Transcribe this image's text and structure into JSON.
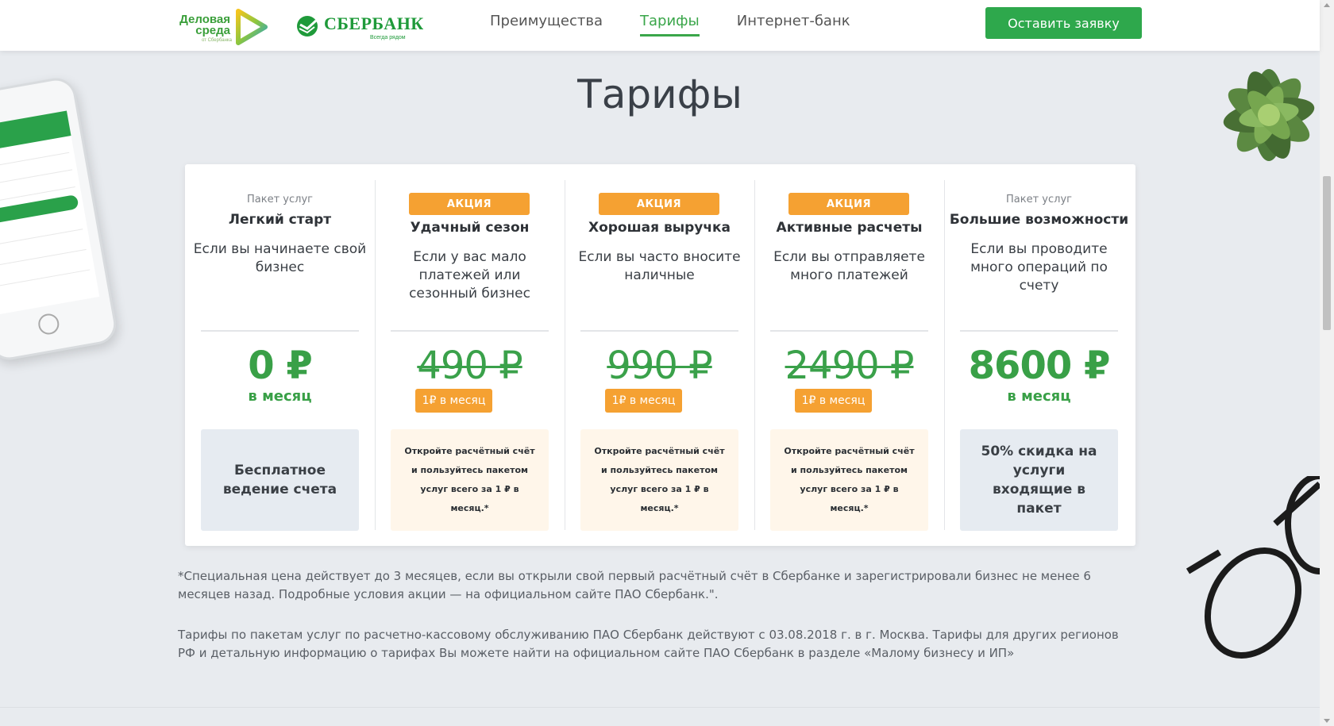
{
  "header": {
    "logo_delovaya": "Деловая среда",
    "logo_delovaya_sub": "от Сбербанка",
    "logo_sberbank": "СБЕРБАНК",
    "logo_sberbank_sub": "Всегда рядом",
    "nav": [
      {
        "label": "Преимущества",
        "active": false
      },
      {
        "label": "Тарифы",
        "active": true
      },
      {
        "label": "Интернет-банк",
        "active": false
      }
    ],
    "cta_label": "Оставить заявку"
  },
  "page_title": "Тарифы",
  "plans": [
    {
      "label": "Пакет услуг",
      "name": "Легкий старт",
      "description": "Если вы начинаете свой бизнес",
      "price": "0 ₽",
      "per_month": "в месяц",
      "box": "Бесплатное ведение счета"
    },
    {
      "badge": "АКЦИЯ",
      "name": "Удачный сезон",
      "description": "Если у вас мало платежей или сезонный бизнес",
      "old_price": "490 ₽",
      "promo_price": "1₽ в месяц",
      "box": "Откройте расчётный счёт и пользуйтесь пакетом услуг всего за 1 ₽ в месяц.*"
    },
    {
      "badge": "АКЦИЯ",
      "name": "Хорошая выручка",
      "description": "Если вы часто вносите наличные",
      "old_price": "990 ₽",
      "promo_price": "1₽ в месяц",
      "box": "Откройте расчётный счёт и пользуйтесь пакетом услуг всего за 1 ₽ в месяц.*"
    },
    {
      "badge": "АКЦИЯ",
      "name": "Активные расчеты",
      "description": "Если вы отправляете много платежей",
      "old_price": "2490 ₽",
      "promo_price": "1₽ в месяц",
      "box": "Откройте расчётный счёт и пользуйтесь пакетом услуг всего за 1 ₽ в месяц.*"
    },
    {
      "label": "Пакет услуг",
      "name": "Большие возможности",
      "description": "Если вы проводите много операций по счету",
      "price": "8600 ₽",
      "per_month": "в месяц",
      "box": "50% скидка на услуги входящие в пакет"
    }
  ],
  "notes": {
    "special": "*Специальная цена действует до 3 месяцев, если вы открыли свой первый расчётный счёт в Сбербанке и зарегистрировали бизнес не менее 6 месяцев назад. Подробные условия акции — на официальном сайте ПАО Сбербанк.\".",
    "regional": "Тарифы по пакетам услуг по расчетно-кассовому обслуживанию ПАО Сбербанк действуют с 03.08.2018 г. в г. Москва. Тарифы для других регионов РФ и детальную информацию о тарифах Вы можете найти на официальном сайте ПАО Сбербанк в разделе «Малому бизнесу и ИП»"
  },
  "colors": {
    "brand_green": "#39a047",
    "promo_orange": "#f5a132",
    "background": "#e8ebef"
  }
}
